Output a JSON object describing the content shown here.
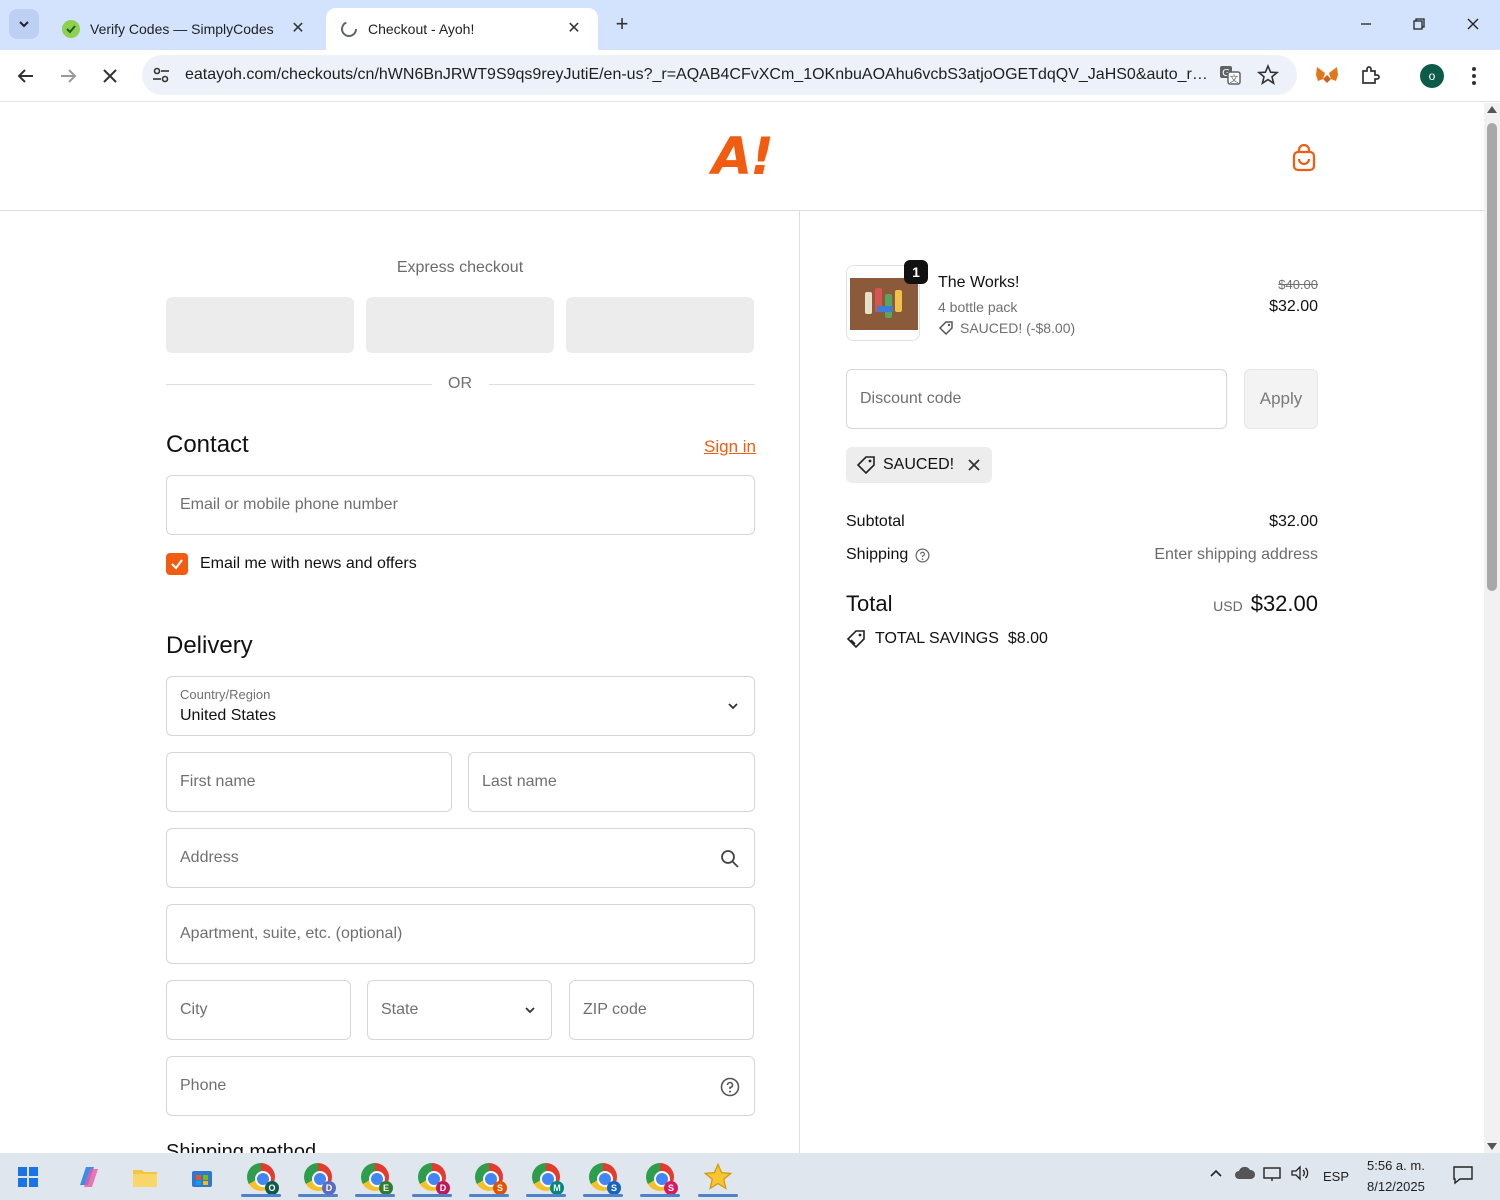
{
  "browser": {
    "tabs": [
      {
        "title": "Verify Codes — SimplyCodes",
        "active": false
      },
      {
        "title": "Checkout - Ayoh!",
        "active": true
      }
    ],
    "url": "eatayoh.com/checkouts/cn/hWN6BnJRWT9S9qs9reyJutiE/en-us?_r=AQAB4CFvXCm_1OKnbuAOAhu6vcbS3atjoOGETdqQV_JaHS0&auto_redi..."
  },
  "header": {
    "logo_text": "A!"
  },
  "express": {
    "title": "Express checkout",
    "or": "OR"
  },
  "contact": {
    "title": "Contact",
    "sign_in": "Sign in",
    "email_placeholder": "Email or mobile phone number",
    "news_label": "Email me with news and offers",
    "news_checked": true
  },
  "delivery": {
    "title": "Delivery",
    "country_label": "Country/Region",
    "country_value": "United States",
    "first_name": "First name",
    "last_name": "Last name",
    "address": "Address",
    "apartment": "Apartment, suite, etc. (optional)",
    "city": "City",
    "state": "State",
    "zip": "ZIP code",
    "phone": "Phone",
    "next_section_partial": "Shipping method"
  },
  "summary": {
    "product": {
      "name": "The Works!",
      "variant": "4 bottle pack",
      "discount": "SAUCED! (-$8.00)",
      "quantity": "1",
      "price_old": "$40.00",
      "price_new": "$32.00"
    },
    "discount_placeholder": "Discount code",
    "apply": "Apply",
    "applied_code": "SAUCED!",
    "subtotal_label": "Subtotal",
    "subtotal_value": "$32.00",
    "shipping_label": "Shipping",
    "shipping_value": "Enter shipping address",
    "total_label": "Total",
    "currency": "USD",
    "total_value": "$32.00",
    "savings_label": "TOTAL SAVINGS",
    "savings_value": "$8.00"
  },
  "taskbar": {
    "language": "ESP",
    "time": "5:56 a. m.",
    "date": "8/12/2025",
    "chrome_profiles": [
      "O",
      "D",
      "E",
      "D",
      "S",
      "M",
      "S",
      "S"
    ]
  },
  "colors": {
    "accent": "#f25c10",
    "tab_bar": "#d3e3fd"
  }
}
